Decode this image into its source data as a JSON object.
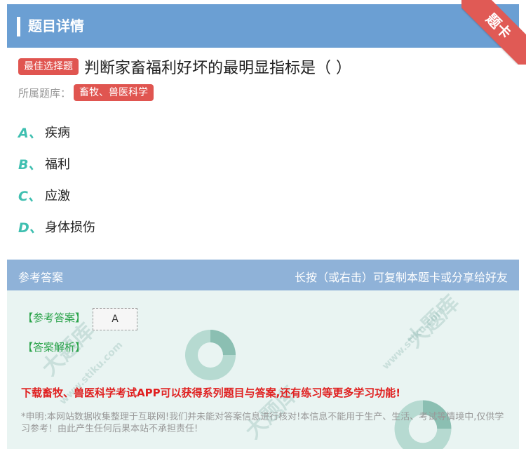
{
  "header": {
    "title": "题目详情",
    "corner_label": "题卡"
  },
  "question": {
    "type_badge": "最佳选择题",
    "text": "判断家畜福利好坏的最明显指标是（ ）",
    "category_label": "所属题库：",
    "category_value": "畜牧、兽医科学"
  },
  "options": [
    {
      "letter": "A、",
      "text": "疾病"
    },
    {
      "letter": "B、",
      "text": "福利"
    },
    {
      "letter": "C、",
      "text": "应激"
    },
    {
      "letter": "D、",
      "text": "身体损伤"
    }
  ],
  "answer_section": {
    "header_left": "参考答案",
    "header_right": "长按（或右击）可复制本题卡或分享给好友",
    "ref_answer_label": "【参考答案】",
    "ref_answer_value": "A",
    "analysis_label": "【答案解析】",
    "promo": "下载畜牧、兽医科学考试APP可以获得系列题目与答案,还有练习等更多学习功能!",
    "disclaimer": "*申明:本网站数据收集整理于互联网!我们并未能对答案信息进行核对!本信息不能用于生产、生活、考试等情境中,仅供学习参考！由此产生任何后果本站不承担责任!"
  },
  "watermark": {
    "text": "大题库",
    "url": "www.stiku.com"
  },
  "colors": {
    "header_bg": "#6b9fd3",
    "accent_red": "#e05550",
    "option_letter": "#3fbfb0",
    "answer_green": "#2aa34a",
    "promo_red": "#e02020"
  }
}
